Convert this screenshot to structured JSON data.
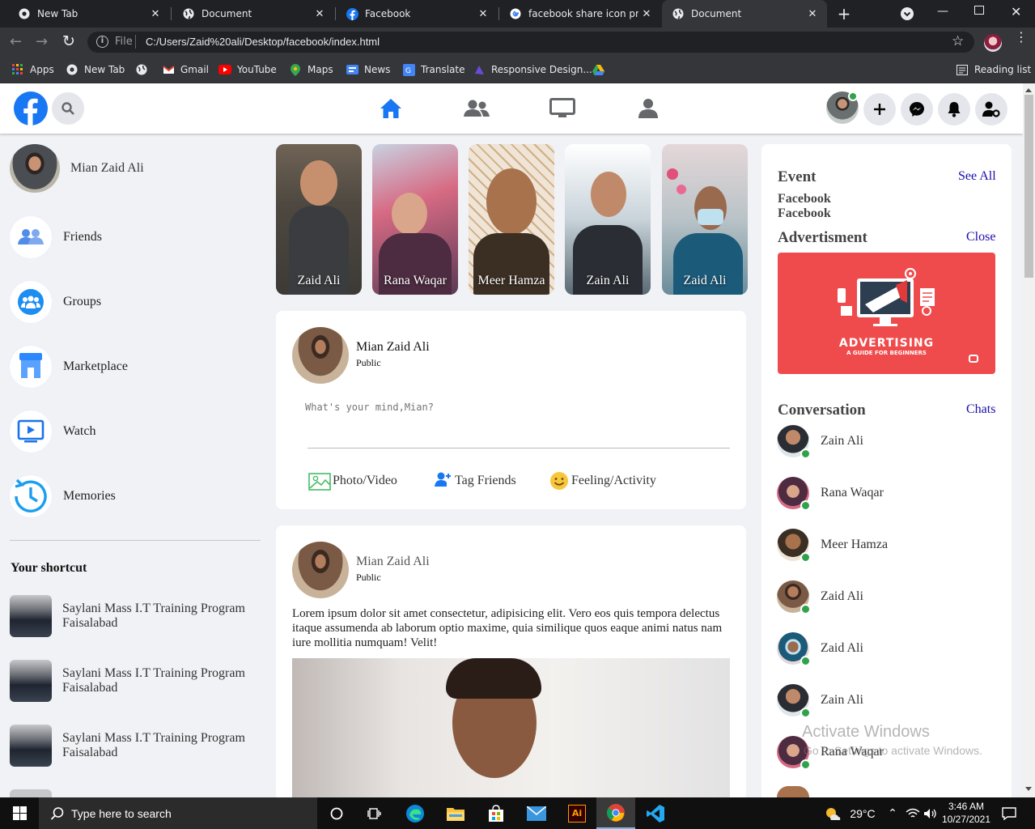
{
  "browser": {
    "tabs": [
      {
        "title": "New Tab",
        "icon": "chrome-icon",
        "active": false
      },
      {
        "title": "Document",
        "icon": "globe-icon",
        "active": false
      },
      {
        "title": "Facebook",
        "icon": "facebook-icon",
        "active": false
      },
      {
        "title": "facebook share icon png -",
        "icon": "google-icon",
        "active": false
      },
      {
        "title": "Document",
        "icon": "globe-icon",
        "active": true
      }
    ],
    "address_prefix": "File",
    "address": "C:/Users/Zaid%20ali/Desktop/facebook/index.html",
    "bookmarks": [
      {
        "label": "Apps",
        "icon": "apps-grid-icon"
      },
      {
        "label": "New Tab",
        "icon": "chrome-icon"
      },
      {
        "label": "",
        "icon": "globe-icon"
      },
      {
        "label": "Gmail",
        "icon": "gmail-icon"
      },
      {
        "label": "YouTube",
        "icon": "youtube-icon"
      },
      {
        "label": "Maps",
        "icon": "maps-icon"
      },
      {
        "label": "News",
        "icon": "news-icon"
      },
      {
        "label": "Translate",
        "icon": "translate-icon"
      },
      {
        "label": "Responsive Design...",
        "icon": "responsive-icon"
      },
      {
        "label": "",
        "icon": "drive-icon"
      }
    ],
    "reading_list": "Reading list"
  },
  "sidebar": {
    "profile_name": "Mian Zaid Ali",
    "items": [
      {
        "label": "Friends",
        "icon": "friends-icon"
      },
      {
        "label": "Groups",
        "icon": "groups-icon"
      },
      {
        "label": "Marketplace",
        "icon": "marketplace-icon"
      },
      {
        "label": "Watch",
        "icon": "watch-icon"
      },
      {
        "label": "Memories",
        "icon": "memories-icon"
      }
    ],
    "shortcut_title": "Your shortcut",
    "shortcuts": [
      {
        "line1": "Saylani Mass I.T Training Program",
        "line2": "Faisalabad"
      },
      {
        "line1": "Saylani Mass I.T Training Program",
        "line2": "Faisalabad"
      },
      {
        "line1": "Saylani Mass I.T Training Program",
        "line2": "Faisalabad"
      }
    ]
  },
  "stories": [
    {
      "name": "Zaid Ali",
      "bg": "#5a5047"
    },
    {
      "name": "Rana Waqar",
      "bg": "#7a4a5a"
    },
    {
      "name": "Meer Hamza",
      "bg": "#b9875c"
    },
    {
      "name": "Zain Ali",
      "bg": "#6c8aa0"
    },
    {
      "name": "Zaid Ali",
      "bg": "#7a9aa8"
    }
  ],
  "composer": {
    "name": "Mian Zaid Ali",
    "privacy": "Public",
    "placeholder": "What's your mind,Mian?",
    "actions": [
      {
        "label": "Photo/Video",
        "icon": "photo-icon"
      },
      {
        "label": "Tag Friends",
        "icon": "tag-friends-icon"
      },
      {
        "label": "Feeling/Activity",
        "icon": "smile-icon"
      }
    ]
  },
  "post": {
    "name": "Mian Zaid Ali",
    "privacy": "Public",
    "text": "Lorem ipsum dolor sit amet consectetur, adipisicing elit. Vero eos quis tempora delectus itaque assumenda ab laborum optio maxime, quia similique quos eaque animi natus nam iure mollitia numquam! Velit!"
  },
  "right": {
    "event_title": "Event",
    "see_all": "See All",
    "event_lines": [
      "Facebook",
      "Facebook"
    ],
    "ad_title": "Advertisment",
    "close": "Close",
    "ad_headline": "ADVERTISING",
    "ad_sub": "A GUIDE FOR BEGINNERS",
    "conv_title": "Conversation",
    "chats": "Chats",
    "conversations": [
      "Zain Ali",
      "Rana Waqar",
      "Meer Hamza",
      "Zaid Ali",
      "Zaid Ali",
      "Zain Ali",
      "Rana Waqar"
    ]
  },
  "watermark": {
    "line1": "Activate Windows",
    "line2": "Go to Settings to activate Windows."
  },
  "taskbar": {
    "search_placeholder": "Type here to search",
    "weather": "29°C",
    "time": "3:46 AM",
    "date": "10/27/2021"
  },
  "colors": {
    "facebook_blue": "#1877f2",
    "online_green": "#31a24c",
    "link_blue": "#1a0dab",
    "ad_red": "#ef4b4c"
  }
}
